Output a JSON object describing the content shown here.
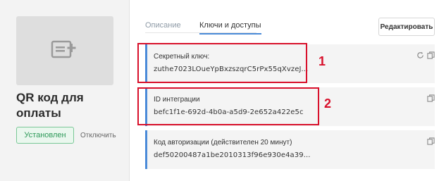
{
  "app": {
    "title": "QR код для оплаты",
    "status": "Установлен",
    "disable_label": "Отключить",
    "thumb_icon": "image-placeholder-icon"
  },
  "tabs": [
    {
      "label": "Описание",
      "active": false
    },
    {
      "label": "Ключи и доступы",
      "active": true
    }
  ],
  "toolbar": {
    "edit_label": "Редактировать"
  },
  "keys": [
    {
      "label": "Секретный ключ:",
      "value": "zuthe7023LOueYpBxzszqrC5rPx55qXvzeJ...",
      "icons": [
        "refresh-icon",
        "copy-icon"
      ]
    },
    {
      "label": "ID интеграции",
      "value": "befc1f1e-692d-4b0a-a5d9-2e652a422e5c",
      "icons": [
        "copy-icon"
      ]
    },
    {
      "label": "Код авторизации (действителен 20 минут)",
      "value": "def50200487a1be2010313f96e930e4a39...",
      "icons": [
        "copy-icon"
      ]
    }
  ],
  "annotations": [
    "1",
    "2"
  ],
  "colors": {
    "accent": "#4a8ad8",
    "highlight": "#d8102b",
    "status": "#2f9a5a"
  }
}
